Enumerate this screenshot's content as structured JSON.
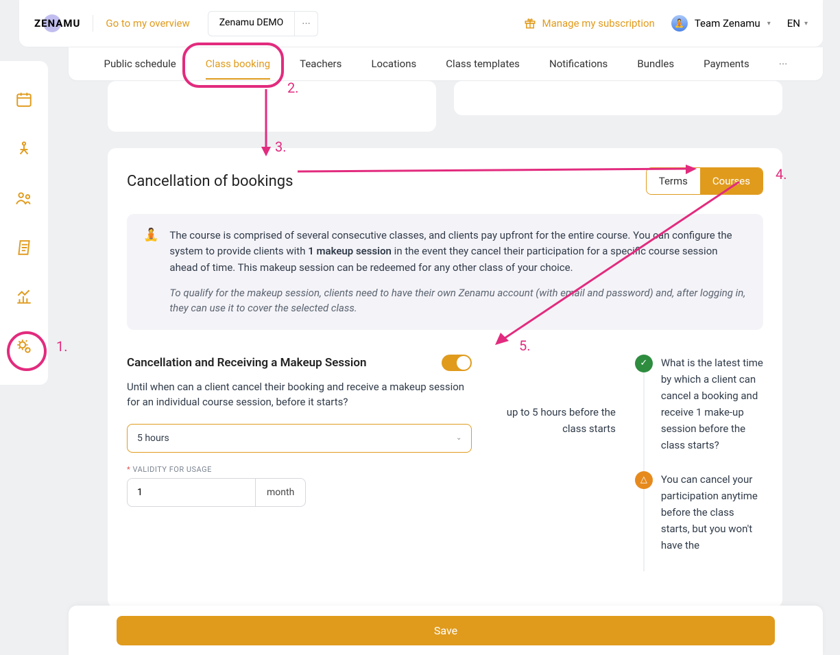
{
  "header": {
    "logo": "ZENAMU",
    "overview_link": "Go to my overview",
    "demo_label": "Zenamu DEMO",
    "subscription_label": "Manage my subscription",
    "user_name": "Team Zenamu",
    "language": "EN"
  },
  "subnav": {
    "items": [
      "Public schedule",
      "Class booking",
      "Teachers",
      "Locations",
      "Class templates",
      "Notifications",
      "Bundles",
      "Payments"
    ],
    "active_index": 1
  },
  "card": {
    "title": "Cancellation of bookings",
    "toggle_left": "Terms",
    "toggle_right": "Courses",
    "info_pre": "The course is comprised of several consecutive classes, and clients pay upfront for the entire course. You can configure the system to provide clients with ",
    "info_strong": "1 makeup session",
    "info_post": " in the event they cancel their participation for a specific course session ahead of time. This makeup session can be redeemed for any other class of your choice.",
    "info_note": "To qualify for the makeup session, clients need to have their own Zenamu account (with email and password) and, after logging in, they can use it to cover the selected class."
  },
  "form": {
    "section_title": "Cancellation and Receiving a Makeup Session",
    "section_desc": "Until when can a client cancel their booking and receive a makeup session for an individual course session, before it starts?",
    "select_value": "5 hours",
    "validity_label": "VALIDITY FOR USAGE",
    "validity_value": "1",
    "validity_unit": "month",
    "summary_text": "up to 5 hours before the class starts",
    "right1": "What is the latest time by which a client can cancel a booking and receive 1 make-up session before the class starts?",
    "right2": "You can cancel your participation anytime before the class starts, but you won't have the"
  },
  "save": {
    "label": "Save"
  },
  "anno": {
    "n1": "1.",
    "n2": "2.",
    "n3": "3.",
    "n4": "4.",
    "n5": "5."
  },
  "sidebar": {
    "icons": [
      "calendar-icon",
      "yoga-icon",
      "people-icon",
      "note-icon",
      "chart-icon",
      "gear-icon"
    ]
  }
}
